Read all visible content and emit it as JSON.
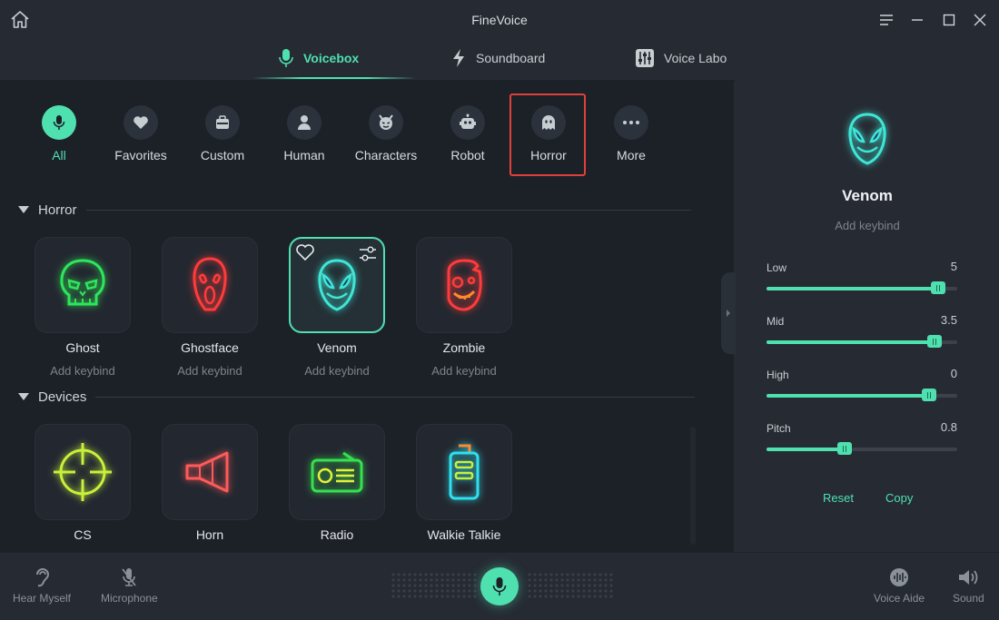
{
  "app": {
    "title": "FineVoice"
  },
  "tabs": [
    {
      "label": "Voicebox",
      "icon": "microphone-icon",
      "active": true
    },
    {
      "label": "Soundboard",
      "icon": "lightning-icon",
      "active": false
    },
    {
      "label": "Voice Labo",
      "icon": "equalizer-icon",
      "active": false
    }
  ],
  "categories": [
    {
      "label": "All",
      "icon": "microphone-icon",
      "active": true
    },
    {
      "label": "Favorites",
      "icon": "heart-icon"
    },
    {
      "label": "Custom",
      "icon": "briefcase-icon"
    },
    {
      "label": "Human",
      "icon": "person-icon"
    },
    {
      "label": "Characters",
      "icon": "devil-face-icon"
    },
    {
      "label": "Robot",
      "icon": "robot-icon"
    },
    {
      "label": "Horror",
      "icon": "ghost-icon",
      "highlighted": true
    },
    {
      "label": "More",
      "icon": "more-dots-icon"
    }
  ],
  "sections": {
    "horror": {
      "title": "Horror",
      "voices": [
        {
          "name": "Ghost",
          "keybind": "Add keybind",
          "icon": "skull-icon",
          "color": "#2ee65a"
        },
        {
          "name": "Ghostface",
          "keybind": "Add keybind",
          "icon": "scream-mask-icon",
          "color": "#ff3b3b"
        },
        {
          "name": "Venom",
          "keybind": "Add keybind",
          "icon": "venom-mask-icon",
          "color": "#3fe6d6",
          "selected": true
        },
        {
          "name": "Zombie",
          "keybind": "Add keybind",
          "icon": "zombie-icon",
          "color": "#ff3b3b"
        }
      ]
    },
    "devices": {
      "title": "Devices",
      "voices": [
        {
          "name": "CS",
          "icon": "crosshair-icon",
          "color": "#c8f03a"
        },
        {
          "name": "Horn",
          "icon": "megaphone-icon",
          "color": "#ff5a5a"
        },
        {
          "name": "Radio",
          "icon": "radio-icon",
          "color": "#36e04f"
        },
        {
          "name": "Walkie Talkie",
          "icon": "walkie-talkie-icon",
          "color": "#2ee0f0"
        }
      ]
    }
  },
  "selected_voice": {
    "name": "Venom",
    "keybind": "Add keybind",
    "sliders": [
      {
        "label": "Low",
        "display": "5",
        "fraction": 0.9
      },
      {
        "label": "Mid",
        "display": "3.5",
        "fraction": 0.88
      },
      {
        "label": "High",
        "display": "0",
        "fraction": 0.85
      },
      {
        "label": "Pitch",
        "display": "0.8",
        "fraction": 0.41
      }
    ],
    "reset_label": "Reset",
    "copy_label": "Copy"
  },
  "bottom": {
    "hear_myself": "Hear Myself",
    "microphone": "Microphone",
    "voice_aide": "Voice Aide",
    "sound": "Sound"
  },
  "colors": {
    "accent": "#4fe0b0",
    "highlight": "#e0403c"
  }
}
